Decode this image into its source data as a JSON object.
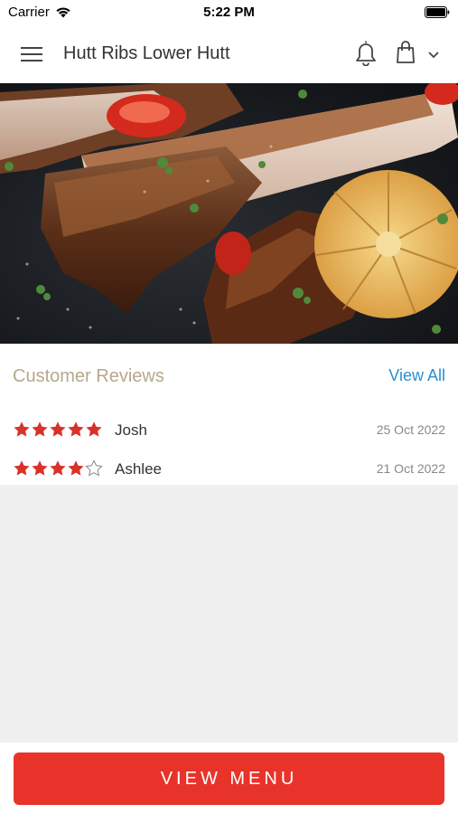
{
  "status_bar": {
    "carrier": "Carrier",
    "time": "5:22 PM"
  },
  "header": {
    "title": "Hutt Ribs Lower Hutt",
    "icons": [
      "menu-icon",
      "bell-icon",
      "shopping-bag-icon",
      "chevron-down-icon"
    ]
  },
  "hero": {
    "image": "grilled-ribs-photo"
  },
  "reviews": {
    "title": "Customer Reviews",
    "view_all_label": "View All",
    "items": [
      {
        "name": "Josh",
        "rating": 5,
        "max_rating": 5,
        "date": "25 Oct 2022"
      },
      {
        "name": "Ashlee",
        "rating": 4,
        "max_rating": 5,
        "date": "21 Oct 2022"
      }
    ]
  },
  "footer": {
    "view_menu_label": "VIEW MENU"
  },
  "colors": {
    "accent": "#e8332a",
    "star": "#d8322b",
    "link": "#2a8fd1",
    "section_title": "#b5a98a"
  }
}
